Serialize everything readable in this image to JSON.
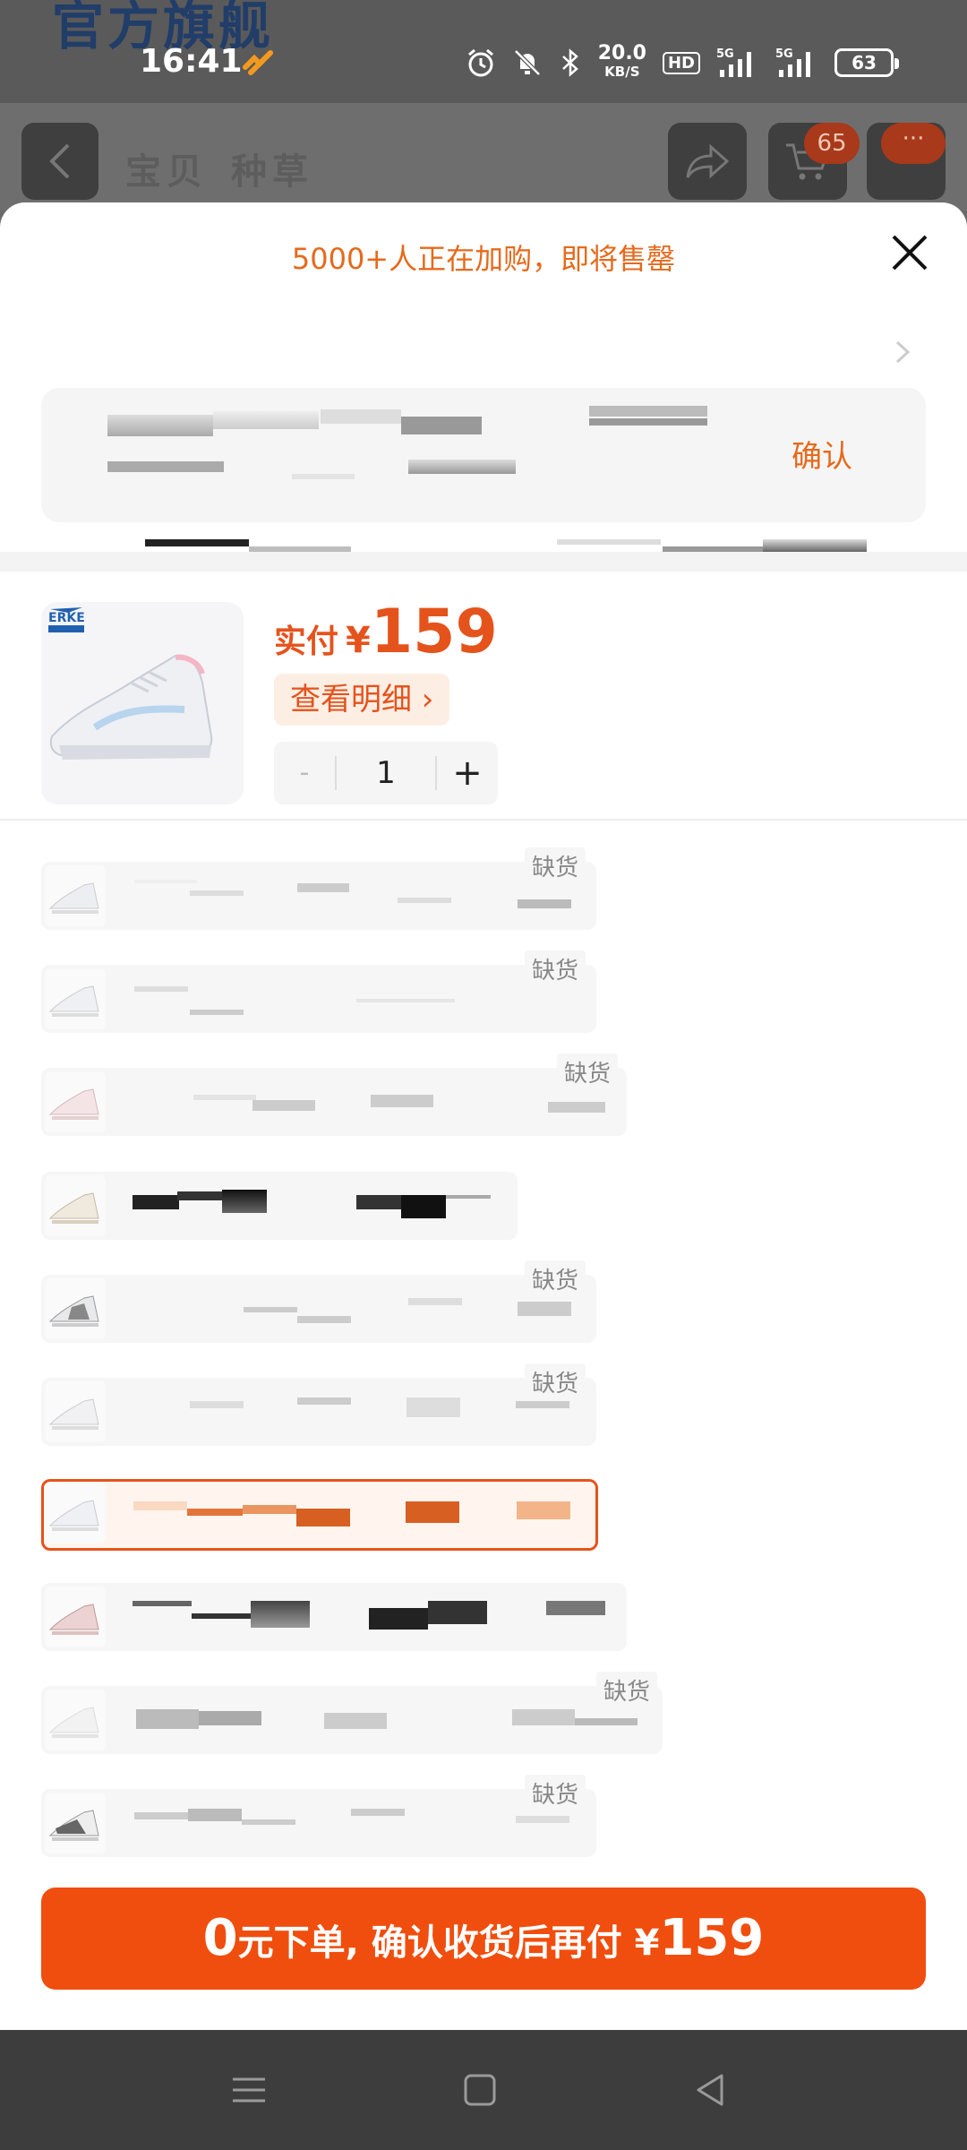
{
  "status_bar": {
    "time": "16:41",
    "brand_watermark": "官方旗舰",
    "net_speed": "20.0",
    "net_unit": "KB/S",
    "hd": "HD",
    "signal1": "5G",
    "signal2": "5G",
    "battery": "63"
  },
  "background_page": {
    "tab1": "宝贝",
    "tab2": "种草",
    "cart_count": "65",
    "more": "···"
  },
  "sheet": {
    "urgency": "5000+人正在加购，即将售罄",
    "confirm": "确认",
    "price_label": "实付",
    "currency": "¥",
    "price": "159",
    "detail": "查看明细 ›",
    "stepper": {
      "minus": "-",
      "quantity": "1",
      "plus": "+"
    },
    "out_of_stock": "缺货",
    "variants": [
      {
        "out_of_stock": true,
        "selected": false
      },
      {
        "out_of_stock": true,
        "selected": false
      },
      {
        "out_of_stock": true,
        "selected": false
      },
      {
        "out_of_stock": false,
        "selected": false
      },
      {
        "out_of_stock": true,
        "selected": false
      },
      {
        "out_of_stock": true,
        "selected": false
      },
      {
        "out_of_stock": false,
        "selected": true
      },
      {
        "out_of_stock": false,
        "selected": false
      },
      {
        "out_of_stock": true,
        "selected": false
      },
      {
        "out_of_stock": true,
        "selected": false
      }
    ],
    "cta": {
      "zero": "0",
      "middle": "元下单, 确认收货后再付 ",
      "currency": "¥",
      "price": "159"
    }
  },
  "colors": {
    "accent": "#f04e0e",
    "accent_text": "#e56a1c",
    "muted": "#888888"
  }
}
